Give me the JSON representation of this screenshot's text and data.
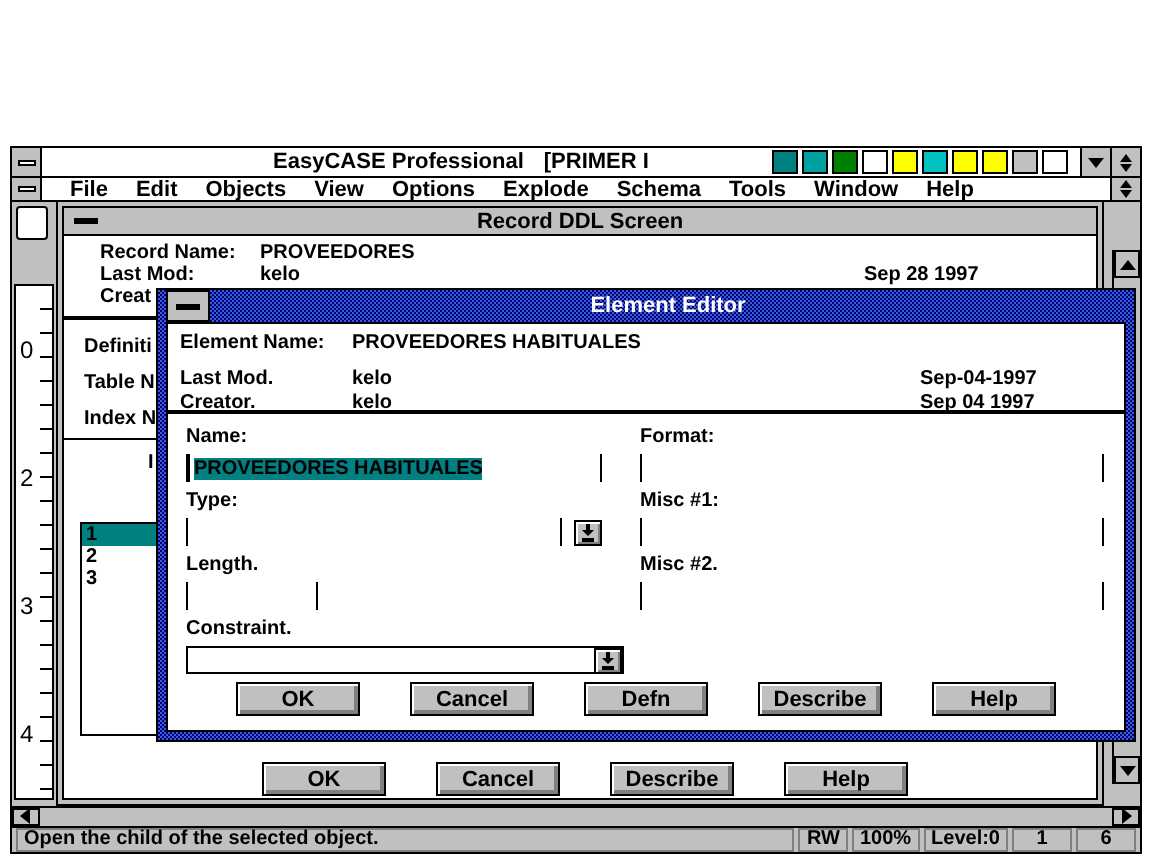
{
  "app_window": {
    "title": "EasyCASE Professional",
    "document": "[PRIMER I",
    "menu": [
      "File",
      "Edit",
      "Objects",
      "View",
      "Options",
      "Explode",
      "Schema",
      "Tools",
      "Window",
      "Help"
    ]
  },
  "ruler": {
    "marks": [
      "0",
      "2",
      "3",
      "4"
    ]
  },
  "record_window": {
    "title": "Record DDL Screen",
    "record_name_label": "Record Name:",
    "record_name": "PROVEEDORES",
    "last_mod_label": "Last Mod:",
    "last_mod": "kelo",
    "last_mod_date": "Sep 28 1997",
    "creator_label": "Creat",
    "fields": [
      "Definiti",
      "Table N",
      "Index N"
    ],
    "list_header": "I",
    "rows": [
      {
        "label": "1",
        "selected": true
      },
      {
        "label": "2",
        "selected": false
      },
      {
        "label": "3",
        "selected": false
      }
    ],
    "buttons": [
      "OK",
      "Cancel",
      "Describe",
      "Help"
    ]
  },
  "element_editor": {
    "title": "Element Editor",
    "element_name_label": "Element Name:",
    "element_name": "PROVEEDORES HABITUALES",
    "last_mod_label": "Last Mod.",
    "last_mod": "kelo",
    "last_mod_date": "Sep-04-1997",
    "creator_label": "Creator.",
    "creator": "kelo",
    "created_date": "Sep 04 1997",
    "left_fields": [
      {
        "label": "Name:",
        "value": "PROVEEDORES HABITUALES",
        "kind": "text",
        "selected": true
      },
      {
        "label": "Type:",
        "kind": "dropdown",
        "selected": false
      },
      {
        "label": "Length.",
        "kind": "short",
        "selected": false
      },
      {
        "label": "Constraint.",
        "kind": "combo",
        "selected": false
      }
    ],
    "right_fields": [
      {
        "label": "Format:",
        "kind": "text",
        "selected": false
      },
      {
        "label": "Misc #1:",
        "kind": "text",
        "selected": false
      },
      {
        "label": "Misc #2.",
        "kind": "text",
        "selected": false
      }
    ],
    "buttons": [
      "OK",
      "Cancel",
      "Defn",
      "Describe",
      "Help"
    ]
  },
  "status_bar": [
    "Open the child of the selected object.",
    "RW",
    "100%",
    "Level:0",
    "1",
    "6"
  ]
}
